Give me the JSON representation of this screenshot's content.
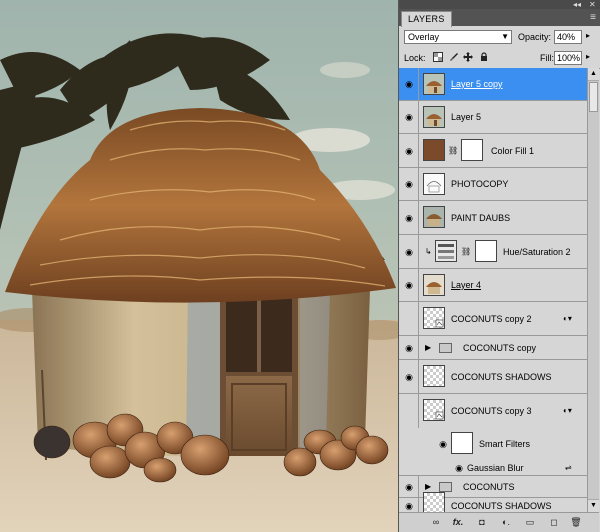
{
  "panel": {
    "tab_label": "LAYERS",
    "collapse_glyph": "◂◂",
    "close_glyph": "✕",
    "menu_glyph": "≡"
  },
  "blend": {
    "mode": "Overlay",
    "arrow": "▼"
  },
  "opacity": {
    "label": "Opacity:",
    "value": "40%",
    "arrow": "▸"
  },
  "lock": {
    "label": "Lock:"
  },
  "fill": {
    "label": "Fill:",
    "value": "100%",
    "arrow": "▸"
  },
  "layers": [
    {
      "name": "Layer 5 copy",
      "visible": true,
      "selected": true,
      "kind": "pixel",
      "underline": true
    },
    {
      "name": "Layer 5",
      "visible": true,
      "kind": "pixel"
    },
    {
      "name": "Color Fill 1",
      "visible": true,
      "kind": "fill"
    },
    {
      "name": "PHOTOCOPY",
      "visible": true,
      "kind": "sketch"
    },
    {
      "name": "PAINT DAUBS",
      "visible": true,
      "kind": "pixel"
    },
    {
      "name": "Hue/Saturation 2",
      "visible": true,
      "kind": "adjust"
    },
    {
      "name": "Layer 4",
      "visible": true,
      "kind": "pixel",
      "underline": true
    },
    {
      "name": "COCONUTS copy 2",
      "visible": false,
      "kind": "smart"
    },
    {
      "name": "COCONUTS copy",
      "visible": true,
      "kind": "group"
    },
    {
      "name": "COCONUTS SHADOWS",
      "visible": true,
      "kind": "transparent"
    },
    {
      "name": "COCONUTS copy 3",
      "visible": false,
      "kind": "smart"
    },
    {
      "name": "Smart Filters",
      "visible": true,
      "kind": "smartfilters"
    },
    {
      "name": "Gaussian Blur",
      "visible": true,
      "kind": "filter"
    },
    {
      "name": "COCONUTS",
      "visible": true,
      "kind": "group"
    },
    {
      "name": "COCONUTS SHADOWS",
      "visible": true,
      "kind": "transparent"
    }
  ],
  "icons": {
    "eye": "◉",
    "lock_transparent": "lock-transparent-icon",
    "lock_image": "brush-icon",
    "lock_position": "move-icon",
    "lock_all": "lock-icon",
    "collapse_triangle": "▶",
    "fx_badge": "◐▾",
    "scroll_up": "▲",
    "scroll_down": "▼"
  },
  "bottom": {
    "link": "∞",
    "fx": "fx.",
    "mask": "◘",
    "adjust": "◐.",
    "group": "▭",
    "new": "◻",
    "trash": "🗑"
  },
  "colors": {
    "selection": "#3a8ff0",
    "panel_bg": "#d6d6d6",
    "color_fill": "#7a4a2a"
  }
}
